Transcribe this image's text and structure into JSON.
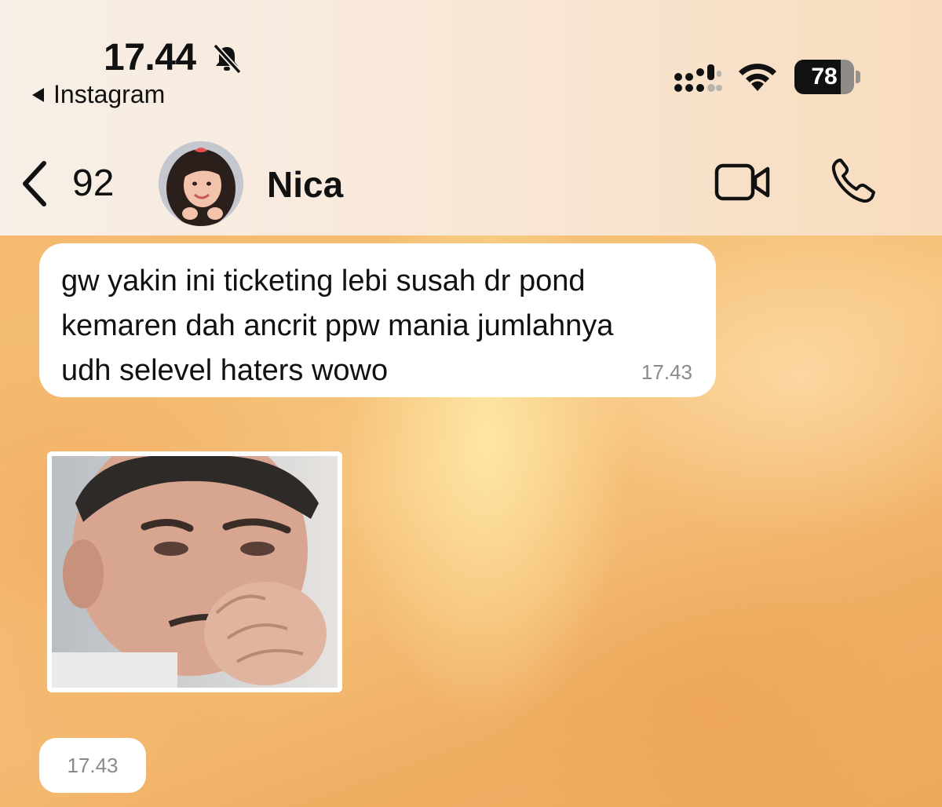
{
  "status_bar": {
    "time": "17.44",
    "back_app_label": "Instagram",
    "battery_level": 78,
    "battery_label": "78"
  },
  "chat_header": {
    "unread_count": "92",
    "contact_name": "Nica"
  },
  "messages": [
    {
      "type": "text",
      "text": "gw yakin ini ticketing lebi susah dr pond\nkemaren dah ancrit ppw mania jumlahnya\nudh selevel haters wowo",
      "time": "17.43"
    },
    {
      "type": "image",
      "time": "17.43"
    }
  ],
  "icons": {
    "bell": "bell-slash-icon",
    "signal": "cellular-signal-icon",
    "wifi": "wifi-icon",
    "back": "chevron-left-icon",
    "video": "video-camera-icon",
    "phone": "phone-icon"
  },
  "colors": {
    "header_bg": "#f8e8d9",
    "wallpaper": "#f4bd72",
    "bubble": "#ffffff",
    "timestamp": "#8a8a8a"
  }
}
